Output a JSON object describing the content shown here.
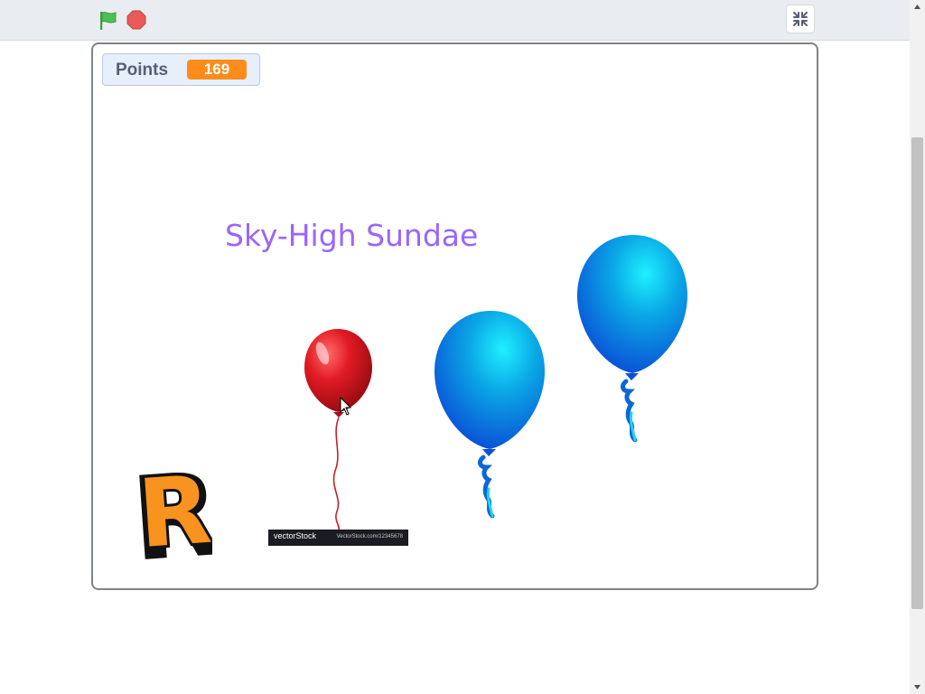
{
  "controls": {
    "green_flag_icon": "green-flag-icon",
    "stop_icon": "stop-sign-icon",
    "fullscreen_icon": "exit-fullscreen-icon",
    "flag_color": "#4cbf56",
    "stop_color": "#ec5959"
  },
  "monitor": {
    "label": "Points",
    "value": "169",
    "value_color": "#ff8c1a"
  },
  "stage": {
    "title": "Sky-High Sundae",
    "title_color": "#9966ff",
    "sprites": {
      "red_balloon": "red-balloon",
      "blue_balloon_1": "blue-balloon",
      "blue_balloon_2": "blue-balloon",
      "letter_sprite": "R"
    },
    "watermark_brand": "vectorStock",
    "watermark_url": "VectorStock.com/12345678"
  }
}
